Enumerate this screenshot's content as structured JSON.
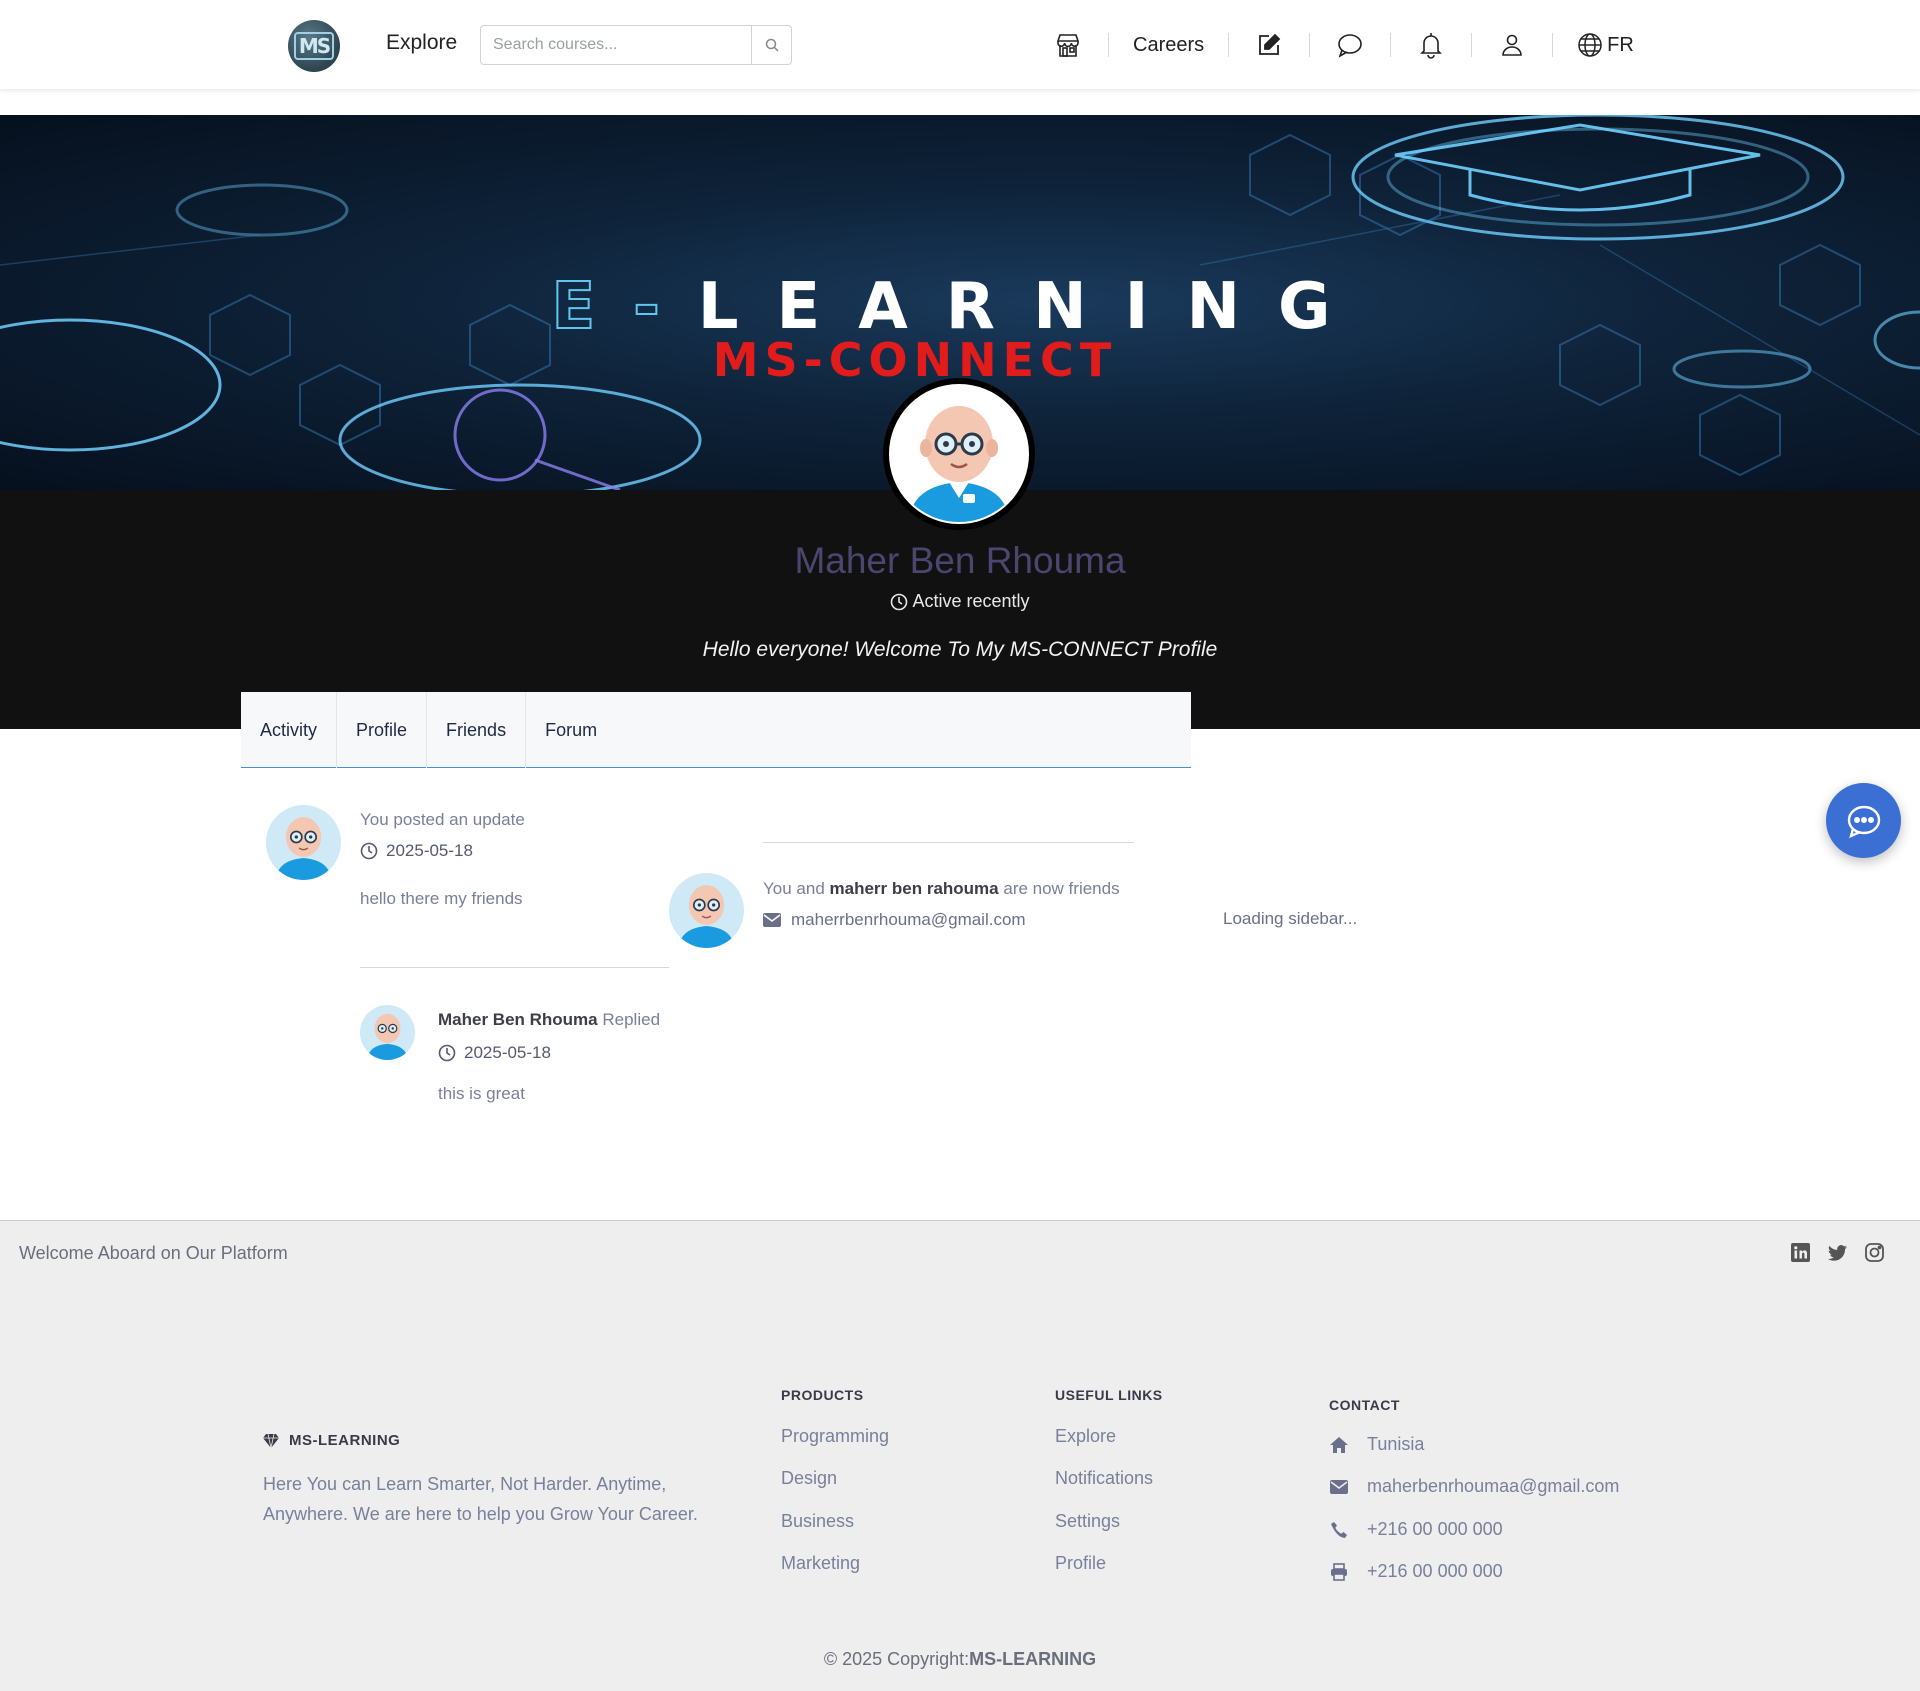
{
  "navbar": {
    "explore": "Explore",
    "search_placeholder": "Search courses...",
    "careers": "Careers",
    "language": "FR"
  },
  "banner": {
    "title_prefix": "E-",
    "title": "LEARNING",
    "subtitle": "MS-CONNECT"
  },
  "profile": {
    "name": "Maher Ben Rhouma",
    "status": "Active recently",
    "bio": "Hello everyone! Welcome To My MS-CONNECT Profile"
  },
  "tabs": [
    "Activity",
    "Profile",
    "Friends",
    "Forum"
  ],
  "activity": {
    "post": {
      "title": "You posted an update",
      "date": "2025-05-18",
      "text": "hello there my friends"
    },
    "reply": {
      "author": "Maher Ben Rhouma",
      "action": "Replied",
      "date": "2025-05-18",
      "text": "this is great"
    },
    "friendship": {
      "prefix": "You and",
      "friend": "maherr ben rahouma",
      "suffix": "are now friends",
      "email": "maherrbenrhouma@gmail.com"
    }
  },
  "sidebar": {
    "loading": "Loading sidebar..."
  },
  "footer": {
    "welcome": "Welcome Aboard on Our Platform",
    "brand": "MS-LEARNING",
    "description": "Here You can Learn Smarter, Not Harder. Anytime, Anywhere. We are here to help you Grow Your Career.",
    "products": {
      "title": "PRODUCTS",
      "links": [
        "Programming",
        "Design",
        "Business",
        "Marketing"
      ]
    },
    "useful_links": {
      "title": "USEFUL LINKS",
      "links": [
        "Explore",
        "Notifications",
        "Settings",
        "Profile"
      ]
    },
    "contact": {
      "title": "CONTACT",
      "location": "Tunisia",
      "email": "maherbenrhoumaa@gmail.com",
      "phone": "+216 00 000 000",
      "fax": "+216 00 000 000"
    },
    "copyright_prefix": "© 2025 Copyright:",
    "copyright_brand": "MS-LEARNING"
  },
  "icons": {
    "store": "store-icon",
    "edit": "edit-icon",
    "chat": "chat-icon",
    "bell": "bell-icon",
    "user": "user-icon",
    "globe": "globe-icon",
    "search": "search-icon",
    "clock": "clock-icon",
    "envelope": "envelope-icon",
    "home": "home-icon",
    "phone": "phone-icon",
    "print": "print-icon",
    "diamond": "diamond-icon",
    "linkedin": "linkedin-icon",
    "twitter": "twitter-icon",
    "instagram": "instagram-icon"
  },
  "colors": {
    "accent": "#3b6fd4",
    "banner_subtitle": "#e21b1b",
    "profile_name": "#4a4670",
    "profile_band": "#111111"
  }
}
